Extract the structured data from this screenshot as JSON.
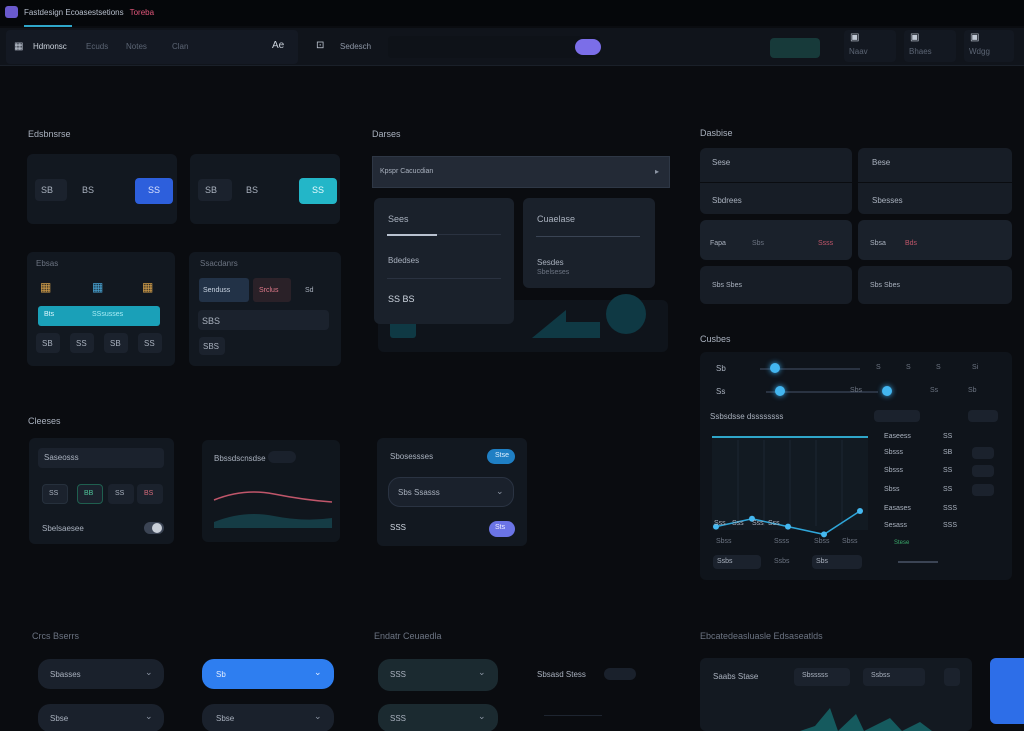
{
  "window": {
    "title": "Fastdesign Ecoasestsetions",
    "title_accent": "Toreba"
  },
  "toolbar": {
    "home_label": "Hdmonsc",
    "nav_items": [
      "Ecuds",
      "Notes",
      "Clan",
      "Ae"
    ],
    "search_label": "Sedesch",
    "search_placeholder": "",
    "user_items": [
      "Naav",
      "Bhaes",
      "Wdgg"
    ]
  },
  "sections": {
    "s1": "Edsbnsrse",
    "s2": "Darses",
    "s3": "Dasbise",
    "s4": "Cleeses",
    "s5": "Cusbes",
    "s6": "Crcs Bserrs",
    "s7": "Endatr Ceuaedla",
    "s8": "Ebcatedeasluasle Edsaseatlds"
  },
  "toggles": {
    "a_left": "SB",
    "a_mid": "BS",
    "a_btn": "SS",
    "b_left": "SB",
    "b_mid": "BS",
    "b_btn": "SS"
  },
  "grid1": {
    "title": "Ebsas",
    "bar": "Bts",
    "bar2": "SSsusses",
    "cells": [
      "SB",
      "SS",
      "SB",
      "SS"
    ]
  },
  "grid2": {
    "title": "Ssacdanrs",
    "tabs": [
      "Senduss",
      "Srclus",
      "Sd"
    ],
    "value": "SBS",
    "btm": "SBS"
  },
  "dropdown": {
    "header": "Kpspr Cacucdian"
  },
  "panelA": {
    "title": "Sees",
    "item": "Bdedses",
    "value": "SS BS"
  },
  "panelB": {
    "title": "Cuaelase",
    "item": "Sesdes",
    "item2": "Sbelseses"
  },
  "dashboard": {
    "tiles": [
      "Sese",
      "Bese",
      "Sbdrees",
      "Sbesses"
    ],
    "rows": [
      {
        "a": "Fapa",
        "b": "Sbs",
        "c": "Ssss"
      },
      {
        "a": "Sbsa",
        "b": "Bds"
      }
    ],
    "bottom": [
      "Sbs Sbes",
      "Sbs Sbes"
    ]
  },
  "controls": {
    "input": "Saseosss",
    "icons": [
      "SS",
      "BB",
      "SS",
      "BS"
    ],
    "toggle_label": "Sbelsaesee"
  },
  "chartcard": {
    "title": "Bbssdscnsdse"
  },
  "settings": {
    "title": "Sbosessses",
    "select": "Sbs Ssasss",
    "value": "SSS",
    "btn": "Sts",
    "tag": "Stse"
  },
  "sliders": {
    "rowA": [
      "Sb",
      "Sb",
      "S",
      "S",
      "S",
      "Si"
    ],
    "rowB": [
      "Ss",
      "Sbs",
      "Ss",
      "Sb"
    ]
  },
  "analytics": {
    "title": "Ssbsdsse dssssssss",
    "x_labels": [
      "Sss",
      "Sss",
      "Sss",
      "Sss"
    ],
    "under": [
      "Sbss",
      "Ssss",
      "Sbss",
      "Sbss"
    ],
    "legend": [
      {
        "name": "Easeess",
        "val": "SS"
      },
      {
        "name": "Sbsss",
        "val": "SB"
      },
      {
        "name": "Sbsss",
        "val": "SS"
      },
      {
        "name": "Sbss",
        "val": "SS"
      },
      {
        "name": "Easases",
        "val": "SSS"
      },
      {
        "name": "Sesass",
        "val": "SSS"
      }
    ],
    "foot": [
      "Ssbs",
      "Ssbs",
      "Stese",
      "Sbs"
    ]
  },
  "chart_data": {
    "type": "line",
    "x": [
      1,
      2,
      3,
      4,
      5
    ],
    "series": [
      {
        "values": [
          3,
          4,
          3,
          2,
          5
        ]
      }
    ],
    "ylim": [
      0,
      10
    ]
  },
  "forms": {
    "selects": [
      "Sbasses",
      "Sb",
      "SSS",
      "Sbse",
      "Sbse",
      "SSS"
    ],
    "status": "Sbsasd Stess",
    "card_title": "Saabs Stase",
    "card_chip": "Sbsssss",
    "card_chip2": "Ssbss"
  },
  "colors": {
    "accent": "#2d5fdc",
    "cyan": "#23b6c8",
    "purple": "#7b6ee8",
    "teal": "#1aa0b8"
  }
}
